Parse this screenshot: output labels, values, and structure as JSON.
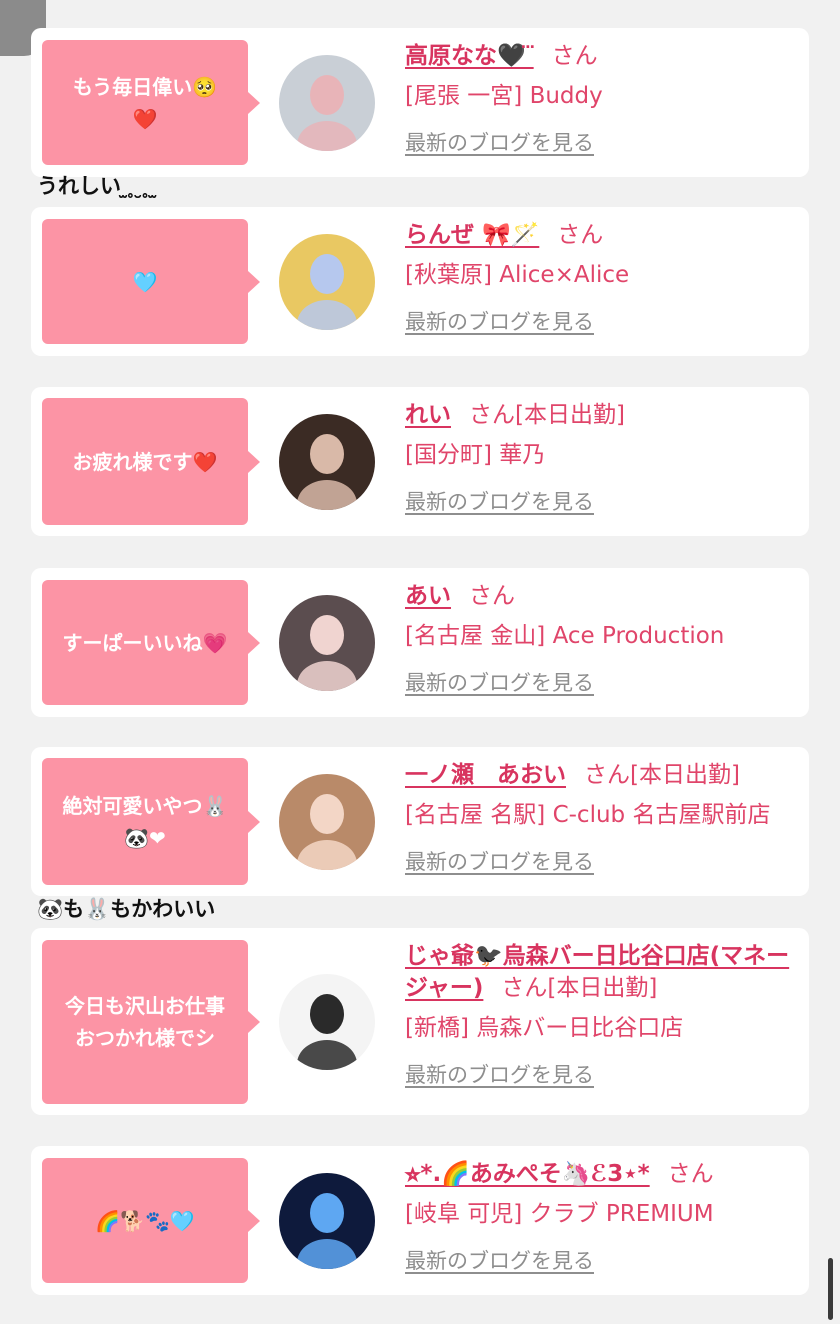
{
  "blog_link_label": "最新のブログを見る",
  "colors": {
    "bubble": "#fc94a5",
    "name": "#d8345f",
    "text": "#e0456a",
    "link": "#8e8e8e"
  },
  "comments": [
    {
      "after_card": 0,
      "text": "うれしい ̫ ̥ ̮ ̥ ̫"
    },
    {
      "after_card": 4,
      "text": "🐼も🐰もかわいい"
    }
  ],
  "cards": [
    {
      "bubble": "もう毎日偉い🥺\n❤️",
      "name": "高原なな🖤 ⃛",
      "san": "さん",
      "shop": "[尾張 一宮] Buddy",
      "avatar": {
        "bg": "#c9cfd6",
        "fg": "#e8b4b8",
        "icon": "portrait-photo"
      }
    },
    {
      "bubble": "🩵",
      "name": "らんぜ 🎀🪄",
      "san": "さん",
      "shop": "[秋葉原] Alice×Alice",
      "avatar": {
        "bg": "#e9c862",
        "fg": "#b6c8ee",
        "icon": "portrait-photo"
      }
    },
    {
      "bubble": "お疲れ様です❤️",
      "name": "れい",
      "san": "さん[本日出勤]",
      "shop": "[国分町] 華乃",
      "avatar": {
        "bg": "#3b2b24",
        "fg": "#d9b9a8",
        "icon": "portrait-photo"
      }
    },
    {
      "bubble": "すーぱーいいね💗",
      "name": "あい",
      "san": "さん",
      "shop": "[名古屋 金山] Ace Production",
      "avatar": {
        "bg": "#5b4d4f",
        "fg": "#f0d4d0",
        "icon": "portrait-photo"
      }
    },
    {
      "bubble": "絶対可愛いやつ🐰\n🐼❤",
      "name": "一ノ瀬　あおい",
      "san": "さん[本日出勤]",
      "shop": "[名古屋 名駅] C-club 名古屋駅前店",
      "avatar": {
        "bg": "#b98a69",
        "fg": "#f3d6c6",
        "icon": "portrait-photo"
      }
    },
    {
      "bubble": "今日も沢山お仕事\nおつかれ様でシ",
      "name": "じゃ爺🐦‍⬛烏森バー日比谷口店(マネージャー)",
      "san": "さん[本日出勤]",
      "shop": "[新橋] 烏森バー日比谷口店",
      "avatar": {
        "bg": "#f4f4f4",
        "fg": "#2a2a2a",
        "icon": "portrait-photo"
      }
    },
    {
      "bubble": "🌈🐕🐾🩵",
      "name": "⭐︎*.🌈あみぺそ🦄ℰ3⋆*",
      "san": "さん",
      "shop": "[岐阜 可児] クラブ PREMIUM",
      "avatar": {
        "bg": "#0e1a3c",
        "fg": "#5ea7f2",
        "icon": "portrait-photo"
      }
    }
  ]
}
